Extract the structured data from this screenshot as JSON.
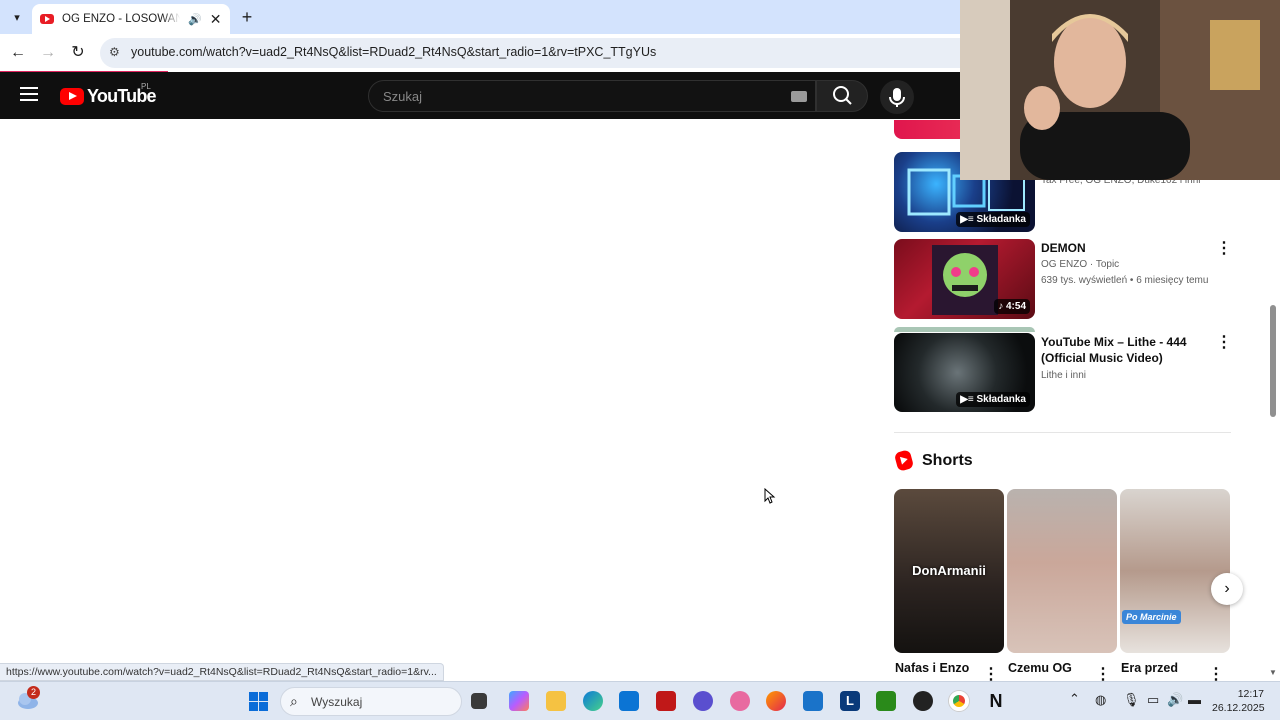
{
  "browser": {
    "tab_title": "OG ENZO - LOSOWANIE - Y",
    "new_tab_glyph": "+",
    "close_glyph": "✕",
    "url": "youtube.com/watch?v=uad2_Rt4NsQ&list=RDuad2_Rt4NsQ&start_radio=1&rv=tPXC_TTgYUs",
    "status_url": "https://www.youtube.com/watch?v=uad2_Rt4NsQ&list=RDuad2_Rt4NsQ&start_radio=1&rv..."
  },
  "youtube": {
    "logo_text": "YouTube",
    "country_code": "PL",
    "search_placeholder": "Szukaj"
  },
  "sidebar": {
    "partial_meta": "Tax Free, OG ENZO, Duke102 i inni",
    "videos": [
      {
        "badge": "Składanka",
        "icon": "playlist-icon"
      },
      {
        "title": "DEMON",
        "channel": "OG ENZO · Topic",
        "stats": "639 tys. wyświetleń • 6 miesięcy temu",
        "badge": "4:54",
        "icon": "music-note-icon"
      },
      {
        "title": "YouTube Mix – Lithe - 444 (Official Music Video)",
        "channel": "Lithe i inni",
        "badge": "Składanka",
        "icon": "playlist-icon"
      }
    ],
    "shorts_heading": "Shorts",
    "shorts": [
      {
        "title": "Nafas i Enzo",
        "overlay": "DonArmanii"
      },
      {
        "title": "Czemu OG",
        "overlay": ""
      },
      {
        "title": "Era przed",
        "overlay": "Po Marcinie"
      }
    ]
  },
  "taskbar": {
    "search_placeholder": "Wyszukaj",
    "weather_badge": "2",
    "time": "12:17",
    "date": "26.12.2025"
  }
}
